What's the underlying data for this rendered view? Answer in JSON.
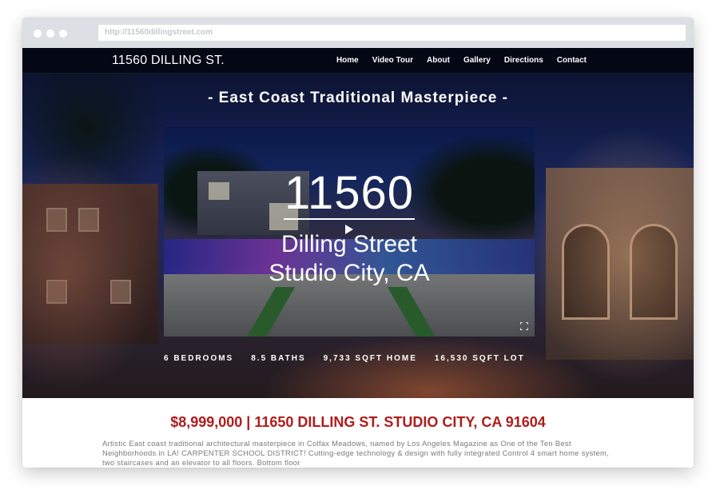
{
  "browser": {
    "url": "http://11560dillingstreet.com"
  },
  "site": {
    "logo": "11560 DILLING ST.",
    "nav": [
      "Home",
      "Video Tour",
      "About",
      "Gallery",
      "Directions",
      "Contact"
    ]
  },
  "hero": {
    "tagline": "- East Coast Traditional Masterpiece -",
    "video": {
      "number": "11560",
      "street": "Dilling Street",
      "city": "Studio City, CA",
      "play_icon": "play-icon",
      "fullscreen_icon": "fullscreen-icon"
    },
    "stats": [
      "6 BEDROOMS",
      "8.5 BATHS",
      "9,733 SQFT HOME",
      "16,530 SQFT LOT"
    ]
  },
  "listing": {
    "price_heading": "$8,999,000 | 11650 DILLING ST. STUDIO CITY, CA 91604",
    "description": "Artistic East coast traditional architectural masterpiece in Colfax Meadows, named by Los Angeles Magazine as One of the Ten Best Neighborhoods in LA! CARPENTER SCHOOL DISTRICT! Cutting-edge technology & design with fully integrated Control 4 smart home system, two staircases and an elevator to all floors. Bottom floor"
  },
  "colors": {
    "accent": "#b01c1c",
    "nav_bg": "#04060f",
    "chrome": "#dcdfe3"
  }
}
